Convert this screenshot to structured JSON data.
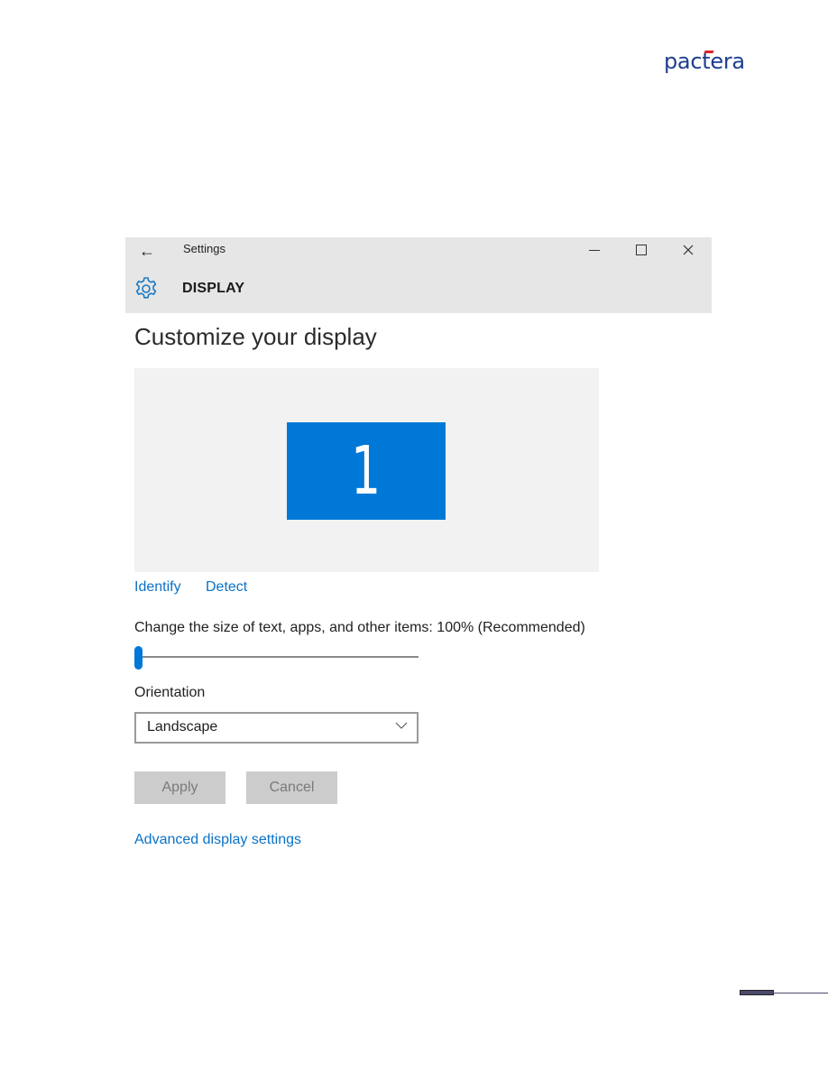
{
  "brand": {
    "logo_text": "pactera",
    "accent": "#1e3f8f",
    "flag_color": "#d9242b"
  },
  "window": {
    "title": "Settings",
    "back_icon": "arrow-left-icon",
    "controls": {
      "minimize": "minimize-icon",
      "maximize": "maximize-icon",
      "close": "close-icon",
      "close_glyph": "✕",
      "back_glyph": "←"
    },
    "section_icon": "gear-icon",
    "section_title": "DISPLAY"
  },
  "main": {
    "heading": "Customize your display",
    "preview": {
      "monitor_number": "1",
      "monitor_color": "#0078d7"
    },
    "links": {
      "identify": "Identify",
      "detect": "Detect",
      "advanced": "Advanced display settings"
    },
    "scale": {
      "label": "Change the size of text, apps, and other items: 100% (Recommended)",
      "value_percent": 100,
      "slider_position": 0
    },
    "orientation": {
      "label": "Orientation",
      "selected": "Landscape"
    },
    "buttons": {
      "apply": "Apply",
      "cancel": "Cancel",
      "enabled": false
    }
  }
}
